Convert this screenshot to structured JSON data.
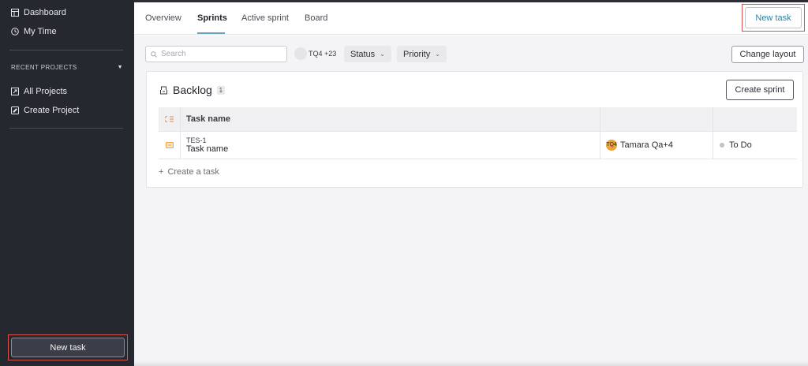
{
  "sidebar": {
    "nav": [
      {
        "label": "Dashboard",
        "icon": "dashboard-icon"
      },
      {
        "label": "My Time",
        "icon": "clock-icon"
      }
    ],
    "section_title": "RECENT PROJECTS",
    "projects": [
      {
        "label": "All Projects",
        "icon": "projects-icon"
      },
      {
        "label": "Create Project",
        "icon": "create-project-icon"
      }
    ],
    "new_task_label": "New task"
  },
  "header": {
    "tabs": [
      {
        "label": "Overview",
        "active": false
      },
      {
        "label": "Sprints",
        "active": true
      },
      {
        "label": "Active sprint",
        "active": false
      },
      {
        "label": "Board",
        "active": false
      }
    ],
    "new_task_label": "New task"
  },
  "filters": {
    "search_placeholder": "Search",
    "assignee_filter": "TQ4 +23",
    "status_label": "Status",
    "priority_label": "Priority",
    "change_layout_label": "Change layout"
  },
  "backlog": {
    "title": "Backlog",
    "count": "1",
    "create_sprint_label": "Create sprint",
    "columns": {
      "task_name": "Task name"
    },
    "tasks": [
      {
        "key": "TES-1",
        "name": "Task name",
        "assignee_initials": "TQ4",
        "assignee": "Tamara Qa+4",
        "status": "To Do"
      }
    ],
    "create_task_label": "Create a task"
  },
  "colors": {
    "sidebar_bg": "#262830",
    "accent": "#2f7fa2",
    "highlight_border": "#d9534f",
    "assignee_avatar": "#f0a23a"
  }
}
